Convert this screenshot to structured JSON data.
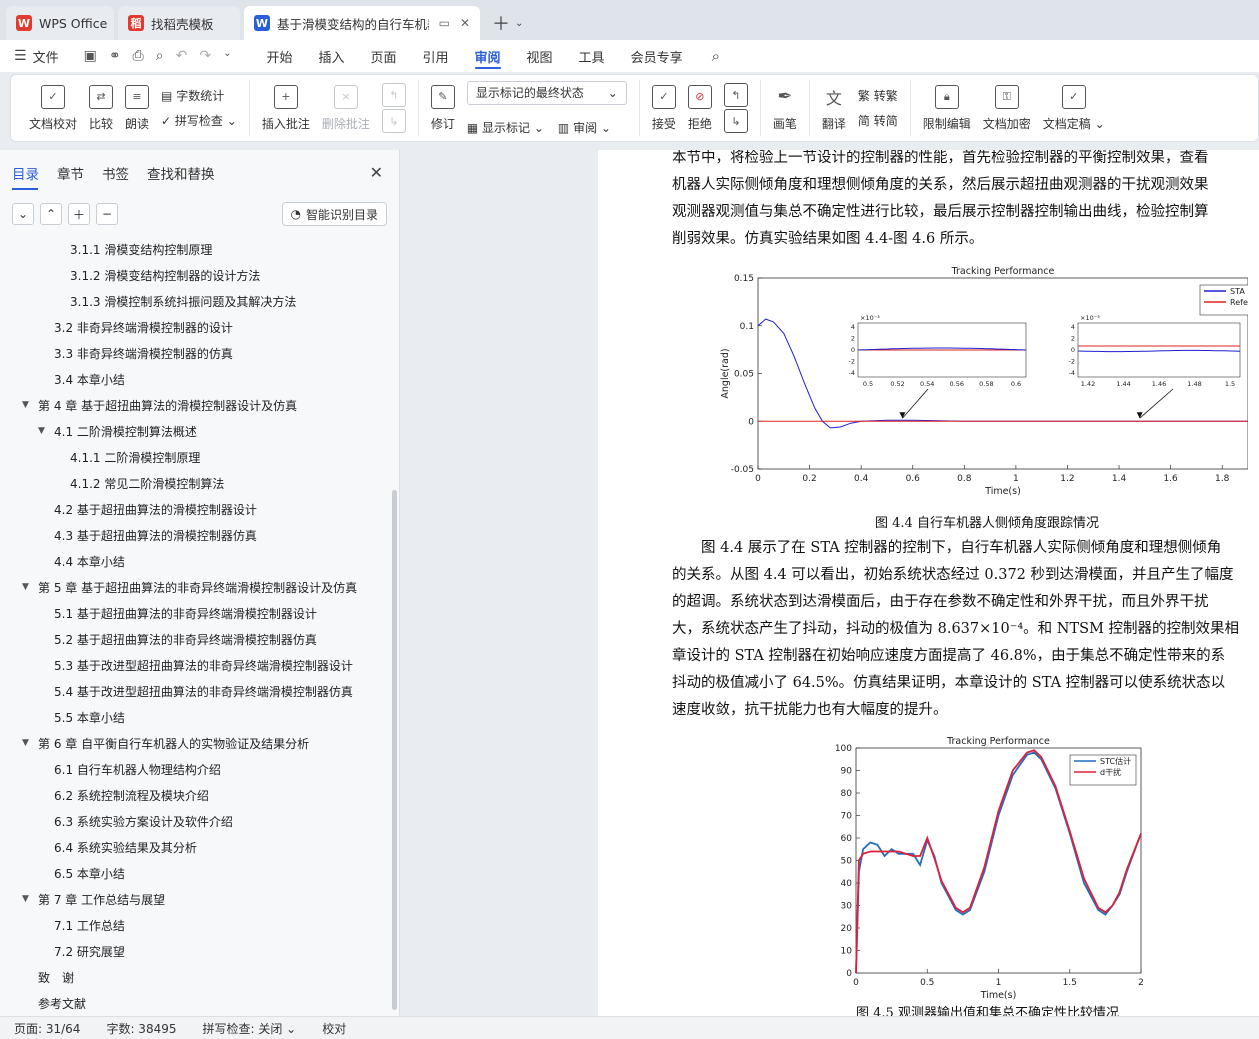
{
  "tabs": [
    {
      "label": "WPS Office",
      "logo": "W",
      "color": "#e33a2f"
    },
    {
      "label": "找稻壳模板",
      "logo": "稻",
      "color": "#e33a2f"
    },
    {
      "label": "基于滑模变结构的自行车机器人",
      "logo": "W",
      "color": "#2b5fd9"
    }
  ],
  "menu": {
    "file": "文件",
    "items": [
      "开始",
      "插入",
      "页面",
      "引用",
      "审阅",
      "视图",
      "工具",
      "会员专享"
    ],
    "active": "审阅"
  },
  "ribbon": {
    "doc_check": "文档校对",
    "compare": "比较",
    "read_aloud": "朗读",
    "word_count": "字数统计",
    "spell_check": "拼写检查",
    "insert_comment": "插入批注",
    "delete_comment": "删除批注",
    "track": "修订",
    "markup_state": "显示标记的最终状态",
    "show_markup": "显示标记",
    "review_pane": "审阅",
    "accept": "接受",
    "reject": "拒绝",
    "pen": "画笔",
    "translate": "翻译",
    "to_traditional": "转繁",
    "to_simplified": "转简",
    "restrict_edit": "限制编辑",
    "encrypt": "文档加密",
    "finalize": "文档定稿"
  },
  "nav": {
    "tabs": [
      "目录",
      "章节",
      "书签",
      "查找和替换"
    ],
    "smart_toc": "智能识别目录",
    "toc": [
      {
        "level": 3,
        "text": "3.1.1 滑模变结构控制原理"
      },
      {
        "level": 3,
        "text": "3.1.2 滑模变结构控制器的设计方法"
      },
      {
        "level": 3,
        "text": "3.1.3 滑模控制系统抖振问题及其解决方法"
      },
      {
        "level": 2,
        "text": "3.2 非奇异终端滑模控制器的设计"
      },
      {
        "level": 2,
        "text": "3.3 非奇异终端滑模控制器的仿真"
      },
      {
        "level": 2,
        "text": "3.4 本章小结"
      },
      {
        "level": 1,
        "text": "第 4 章 基于超扭曲算法的滑模控制器设计及仿真",
        "expanded": true
      },
      {
        "level": 2,
        "text": "4.1 二阶滑模控制算法概述",
        "expanded": true
      },
      {
        "level": 3,
        "text": "4.1.1 二阶滑模控制原理"
      },
      {
        "level": 3,
        "text": "4.1.2 常见二阶滑模控制算法"
      },
      {
        "level": 2,
        "text": "4.2 基于超扭曲算法的滑模控制器设计"
      },
      {
        "level": 2,
        "text": "4.3 基于超扭曲算法的滑模控制器仿真"
      },
      {
        "level": 2,
        "text": "4.4 本章小结"
      },
      {
        "level": 1,
        "text": "第 5 章 基于超扭曲算法的非奇异终端滑模控制器设计及仿真",
        "expanded": true
      },
      {
        "level": 2,
        "text": "5.1 基于超扭曲算法的非奇异终端滑模控制器设计"
      },
      {
        "level": 2,
        "text": "5.2 基于超扭曲算法的非奇异终端滑模控制器仿真"
      },
      {
        "level": 2,
        "text": "5.3 基于改进型超扭曲算法的非奇异终端滑模控制器设计"
      },
      {
        "level": 2,
        "text": "5.4 基于改进型超扭曲算法的非奇异终端滑模控制器仿真"
      },
      {
        "level": 2,
        "text": "5.5 本章小结"
      },
      {
        "level": 1,
        "text": "第 6 章 自平衡自行车机器人的实物验证及结果分析",
        "expanded": true
      },
      {
        "level": 2,
        "text": "6.1 自行车机器人物理结构介绍"
      },
      {
        "level": 2,
        "text": "6.2 系统控制流程及模块介绍"
      },
      {
        "level": 2,
        "text": "6.3 系统实验方案设计及软件介绍"
      },
      {
        "level": 2,
        "text": "6.4 系统实验结果及其分析"
      },
      {
        "level": 2,
        "text": "6.5 本章小结"
      },
      {
        "level": 1,
        "text": "第 7 章 工作总结与展望",
        "expanded": true
      },
      {
        "level": 2,
        "text": "7.1 工作总结"
      },
      {
        "level": 2,
        "text": "7.2 研究展望"
      },
      {
        "level": 1,
        "text": "致　谢"
      },
      {
        "level": 1,
        "text": "参考文献"
      }
    ]
  },
  "doc": {
    "para1": [
      "本节中，将检验上一节设计的控制器的性能，首先检验控制器的平衡控制效果，查看",
      "机器人实际侧倾角度和理想侧倾角度的关系，然后展示超扭曲观测器的干扰观测效果",
      "观测器观测值与集总不确定性进行比较，最后展示控制器控制输出曲线，检验控制算",
      "削弱效果。仿真实验结果如图 4.4-图 4.6 所示。"
    ],
    "fig44_caption": "图 4.4  自行车机器人侧倾角度跟踪情况",
    "para2": [
      "　　图 4.4 展示了在 STA 控制器的控制下，自行车机器人实际侧倾角度和理想侧倾角",
      "的关系。从图 4.4 可以看出，初始系统状态经过 0.372 秒到达滑模面，并且产生了幅度",
      "的超调。系统状态到达滑模面后，由于存在参数不确定性和外界干扰，而且外界干扰",
      "大，系统状态产生了抖动，抖动的极值为 8.637×10⁻⁴。和 NTSM 控制器的控制效果相",
      "章设计的 STA 控制器在初始响应速度方面提高了 46.8%，由于集总不确定性带来的系",
      "抖动的极值减小了 64.5%。仿真结果证明，本章设计的 STA 控制器可以使系统状态以",
      "速度收敛，抗干扰能力也有大幅度的提升。"
    ],
    "fig45_caption": "图 4.5  观测器输出值和集总不确定性比较情况"
  },
  "chart_data": [
    {
      "type": "line",
      "title": "Tracking Performance",
      "xlabel": "Time(s)",
      "ylabel": "Angle(rad)",
      "xlim": [
        0,
        1.9
      ],
      "ylim": [
        -0.05,
        0.15
      ],
      "xticks": [
        0,
        0.2,
        0.4,
        0.6,
        0.8,
        1,
        1.2,
        1.4,
        1.6,
        1.8
      ],
      "yticks": [
        -0.05,
        0,
        0.05,
        0.1,
        0.15
      ],
      "legend": "top-right",
      "series": [
        {
          "name": "STA",
          "color": "#1f1fd6",
          "x": [
            0,
            0.03,
            0.06,
            0.1,
            0.14,
            0.18,
            0.22,
            0.25,
            0.28,
            0.32,
            0.36,
            0.4,
            0.5,
            0.6,
            0.8,
            1.0,
            1.2,
            1.4,
            1.6,
            1.8,
            1.9
          ],
          "y": [
            0.1,
            0.107,
            0.104,
            0.092,
            0.068,
            0.04,
            0.014,
            0.0,
            -0.007,
            -0.006,
            -0.002,
            0.0,
            0.001,
            0.001,
            0.0,
            0.0,
            0.0,
            0.0,
            0.0,
            0.0,
            0.0
          ]
        },
        {
          "name": "Reference",
          "color": "#e02020",
          "x": [
            0,
            1.9
          ],
          "y": [
            0,
            0
          ]
        }
      ],
      "insets": [
        {
          "exponent": "×10⁻³",
          "xticks": [
            "0.5",
            "0.52",
            "0.54",
            "0.56",
            "0.58",
            "0.6"
          ],
          "yticks": [
            "4",
            "2",
            "0",
            "-2",
            "-4"
          ]
        },
        {
          "exponent": "×10⁻³",
          "xticks": [
            "1.42",
            "1.44",
            "1.46",
            "1.48",
            "1.5"
          ],
          "yticks": [
            "4",
            "2",
            "0",
            "-2",
            "-4"
          ]
        }
      ]
    },
    {
      "type": "line",
      "title": "Tracking Performance",
      "xlabel": "Time(s)",
      "ylabel": "",
      "xlim": [
        0,
        2
      ],
      "ylim": [
        0,
        100
      ],
      "xticks": [
        0,
        0.5,
        1,
        1.5,
        2
      ],
      "yticks": [
        0,
        10,
        20,
        30,
        40,
        50,
        60,
        70,
        80,
        90,
        100
      ],
      "legend": "top-right",
      "series": [
        {
          "name": "STC估计",
          "color": "#1f6fc0",
          "x": [
            0,
            0.02,
            0.05,
            0.1,
            0.15,
            0.2,
            0.25,
            0.3,
            0.4,
            0.45,
            0.5,
            0.55,
            0.6,
            0.7,
            0.75,
            0.8,
            0.9,
            1.0,
            1.1,
            1.2,
            1.25,
            1.3,
            1.4,
            1.5,
            1.6,
            1.7,
            1.75,
            1.8,
            1.85,
            1.9,
            2.0
          ],
          "y": [
            0,
            45,
            55,
            58,
            57,
            52,
            55,
            53,
            53,
            48,
            59,
            52,
            40,
            28,
            26,
            28,
            45,
            70,
            88,
            97,
            98,
            95,
            82,
            62,
            40,
            28,
            26,
            30,
            35,
            45,
            62
          ]
        },
        {
          "name": "d干扰",
          "color": "#e0203a",
          "x": [
            0,
            0.02,
            0.05,
            0.1,
            0.15,
            0.2,
            0.25,
            0.3,
            0.4,
            0.45,
            0.5,
            0.55,
            0.6,
            0.7,
            0.75,
            0.8,
            0.9,
            1.0,
            1.1,
            1.2,
            1.25,
            1.3,
            1.4,
            1.5,
            1.6,
            1.7,
            1.75,
            1.8,
            1.85,
            1.9,
            2.0
          ],
          "y": [
            0,
            50,
            53,
            54,
            54,
            54,
            54,
            54,
            52,
            52,
            60,
            51,
            41,
            29,
            27,
            29,
            47,
            72,
            90,
            98,
            99,
            96,
            83,
            63,
            42,
            29,
            27,
            30,
            36,
            46,
            62
          ]
        }
      ]
    }
  ],
  "status": {
    "page": "页面: 31/64",
    "words": "字数: 38495",
    "spell": "拼写检查: 关闭",
    "proof": "校对"
  }
}
